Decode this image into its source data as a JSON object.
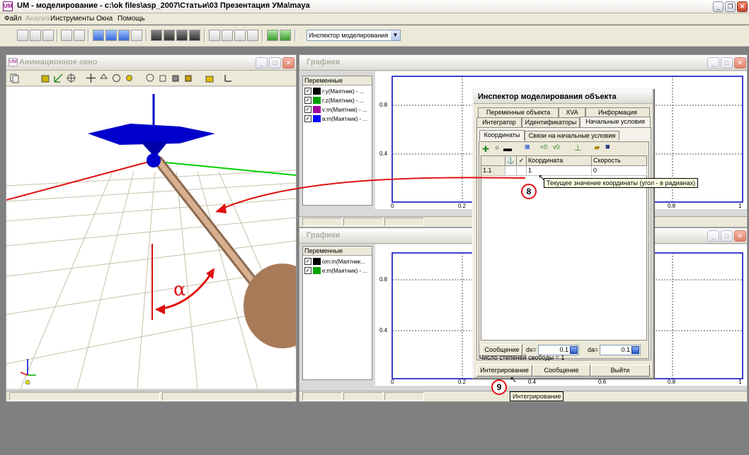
{
  "app": {
    "title": "UM - моделирование - c:\\ok files\\asp_2007\\Статьи\\03 Презентация УМа\\maya",
    "icon_text": "UM"
  },
  "menu": {
    "items": [
      {
        "label": "Файл",
        "enabled": true
      },
      {
        "label": "Анализ",
        "enabled": false
      },
      {
        "label": "Инструменты",
        "enabled": true
      },
      {
        "label": "Окна",
        "enabled": true
      },
      {
        "label": "Помощь",
        "enabled": true
      }
    ]
  },
  "toolbar": {
    "combo_value": "Инспектор моделирования"
  },
  "animation_window": {
    "title": "Анимационное окно",
    "alpha_label": "α"
  },
  "graph1": {
    "title": "Графики",
    "vars_header": "Переменные",
    "variables": [
      {
        "label": "r:y(Маятник) - ...",
        "color": "#000000"
      },
      {
        "label": "r:z(Маятник) - ...",
        "color": "#00a000"
      },
      {
        "label": "v:m(Маятник) - ...",
        "color": "#a000a0"
      },
      {
        "label": "a:m(Маятник) - ...",
        "color": "#0000ff"
      }
    ],
    "y_ticks": [
      "0.8",
      "0.4"
    ],
    "x_ticks": [
      "0",
      "0.2",
      "0.8",
      "1"
    ]
  },
  "graph2": {
    "title": "Графики",
    "vars_header": "Переменные",
    "variables": [
      {
        "label": "om:m(Маятник...",
        "color": "#000000"
      },
      {
        "label": "e:m(Маятник) - ...",
        "color": "#00a000"
      }
    ],
    "y_ticks": [
      "0.8",
      "0.4"
    ],
    "x_ticks": [
      "0",
      "0.2",
      "0.4",
      "0.6",
      "0.8",
      "1"
    ]
  },
  "inspector": {
    "title": "Инспектор моделирования объекта",
    "tabs_row1": [
      "Переменные объекта",
      "XVA",
      "Информация"
    ],
    "tabs_row2": [
      "Интегратор",
      "Идентификаторы",
      "Начальные условия"
    ],
    "subtabs": [
      "Координаты",
      "Связи на начальные условия"
    ],
    "grid_headers": {
      "anchor": "⚓",
      "check": "✓",
      "coordinate": "Координата",
      "speed": "Скорость"
    },
    "grid_rows": [
      {
        "id": "1.1",
        "coordinate": "1",
        "speed": "0"
      }
    ],
    "message_button": "Сообщение",
    "dx_label": "dx=",
    "dx_value": "0.1",
    "da_label": "da=",
    "da_value": "0.1",
    "dof_text": "Число степеней свободы = 1",
    "integrate_button": "Интегрирование",
    "message_button2": "Сообщение",
    "exit_button": "Выйти"
  },
  "annotations": {
    "badge8": "8",
    "badge9": "9",
    "tooltip_coord": "Текущее значение координаты (угол - в радианах)",
    "tooltip_integrate": "Интегрирование"
  },
  "colors": {
    "plot_frame": "#0000c0",
    "annotation_red": "#e01010",
    "rod": "#c89a78",
    "pendulum_base": "#0000cc"
  }
}
